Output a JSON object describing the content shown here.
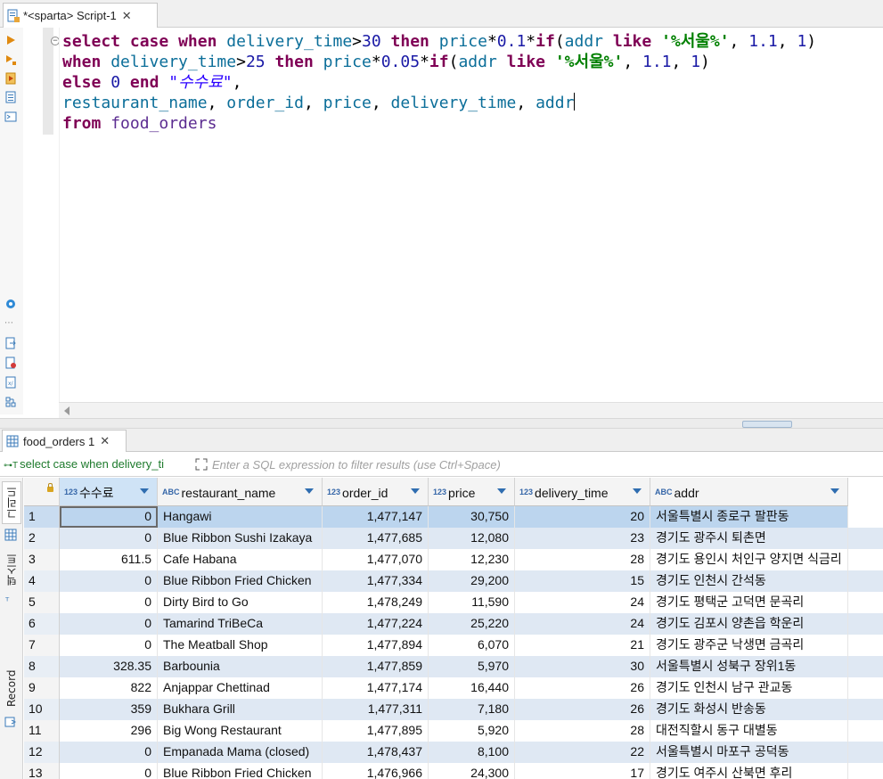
{
  "editor": {
    "tab_title": "*<sparta> Script-1",
    "code": {
      "line1": {
        "kw_select": "select",
        "kw_case": "case",
        "kw_when": "when",
        "col": "delivery_time",
        "op1": ">",
        "num1": "30",
        "kw_then": "then",
        "col_price": "price",
        "op2": "*",
        "num2": "0.1",
        "op3": "*",
        "kw_if": "if",
        "paren_open": "(",
        "col_addr": "addr",
        "kw_like": "like",
        "str": "'%서울%'",
        "sep1": ", ",
        "num3": "1.1",
        "sep2": ", ",
        "num4": "1",
        "paren_close": ")"
      },
      "line2": {
        "kw_when": "when",
        "col": "delivery_time",
        "op1": ">",
        "num1": "25",
        "kw_then": "then",
        "col_price": "price",
        "op2": "*",
        "num2": "0.05",
        "op3": "*",
        "kw_if": "if",
        "paren_open": "(",
        "col_addr": "addr",
        "kw_like": "like",
        "str": "'%서울%'",
        "sep1": ", ",
        "num3": "1.1",
        "sep2": ", ",
        "num4": "1",
        "paren_close": ")"
      },
      "line3": {
        "kw_else": "else",
        "num": "0",
        "kw_end": "end",
        "alias": "\"수수료\"",
        "comma": ","
      },
      "line4": {
        "c1": "restaurant_name",
        "s1": ", ",
        "c2": "order_id",
        "s2": ", ",
        "c3": "price",
        "s3": ", ",
        "c4": "delivery_time",
        "s4": ", ",
        "c5": "addr"
      },
      "line5": {
        "kw_from": "from",
        "table": "food_orders"
      }
    }
  },
  "results": {
    "tab_title": "food_orders 1",
    "query_label": "select case when delivery_ti",
    "filter_placeholder": "Enter a SQL expression to filter results (use Ctrl+Space)",
    "side_tabs": {
      "grid": "그리드",
      "text": "텍스트",
      "record": "Record"
    },
    "type_labels": {
      "num": "123",
      "str": "ABC"
    },
    "columns": [
      "수수료",
      "restaurant_name",
      "order_id",
      "price",
      "delivery_time",
      "addr"
    ],
    "rows": [
      [
        "1",
        "0",
        "Hangawi",
        "1,477,147",
        "30,750",
        "20",
        "서울특별시 종로구 팔판동"
      ],
      [
        "2",
        "0",
        "Blue Ribbon Sushi Izakaya",
        "1,477,685",
        "12,080",
        "23",
        "경기도 광주시 퇴촌면"
      ],
      [
        "3",
        "611.5",
        "Cafe Habana",
        "1,477,070",
        "12,230",
        "28",
        "경기도 용인시 처인구 양지면 식금리"
      ],
      [
        "4",
        "0",
        "Blue Ribbon Fried Chicken",
        "1,477,334",
        "29,200",
        "15",
        "경기도 인천시 간석동"
      ],
      [
        "5",
        "0",
        "Dirty Bird to Go",
        "1,478,249",
        "11,590",
        "24",
        "경기도 평택군 고덕면 문곡리"
      ],
      [
        "6",
        "0",
        "Tamarind TriBeCa",
        "1,477,224",
        "25,220",
        "24",
        "경기도 김포시 양촌읍 학운리"
      ],
      [
        "7",
        "0",
        "The Meatball Shop",
        "1,477,894",
        "6,070",
        "21",
        "경기도 광주군 낙생면 금곡리"
      ],
      [
        "8",
        "328.35",
        "Barbounia",
        "1,477,859",
        "5,970",
        "30",
        "서울특별시 성북구 장위1동"
      ],
      [
        "9",
        "822",
        "Anjappar Chettinad",
        "1,477,174",
        "16,440",
        "26",
        "경기도 인천시 남구 관교동"
      ],
      [
        "10",
        "359",
        "Bukhara Grill",
        "1,477,311",
        "7,180",
        "26",
        "경기도 화성시 반송동"
      ],
      [
        "11",
        "296",
        "Big Wong Restaurant",
        "1,477,895",
        "5,920",
        "28",
        "대전직할시 동구 대별동"
      ],
      [
        "12",
        "0",
        "Empanada Mama (closed)",
        "1,478,437",
        "8,100",
        "22",
        "서울특별시 마포구 공덕동"
      ],
      [
        "13",
        "0",
        "Blue Ribbon Fried Chicken",
        "1,476,966",
        "24,300",
        "17",
        "경기도 여주시 산북면 후리"
      ]
    ]
  },
  "colors": {
    "keyword": "#7f0055",
    "column": "#0b6e99",
    "number": "#1a1aa6",
    "string": "#008000",
    "alias": "#2a00ff",
    "table": "#5c2d91",
    "row_alt": "#dfe8f3",
    "row_selected": "#bcd5ee",
    "accent": "#2f6db0"
  },
  "icons": {
    "tab": "sql-script-icon",
    "tab_close": "close-icon",
    "toolbar": [
      "execute-icon",
      "execute-script-icon",
      "explain-plan-icon",
      "load-script-icon",
      "save-script-icon",
      "settings-icon",
      "export-icon",
      "format-icon",
      "template-icon",
      "outline-icon"
    ],
    "results_tab": "table-icon",
    "filter": "filter-icon",
    "expand": "expand-icon",
    "side": [
      "grid-icon",
      "text-icon",
      "record-icon"
    ],
    "lock": "lock-icon",
    "column_menu": "chevron-down-icon"
  }
}
